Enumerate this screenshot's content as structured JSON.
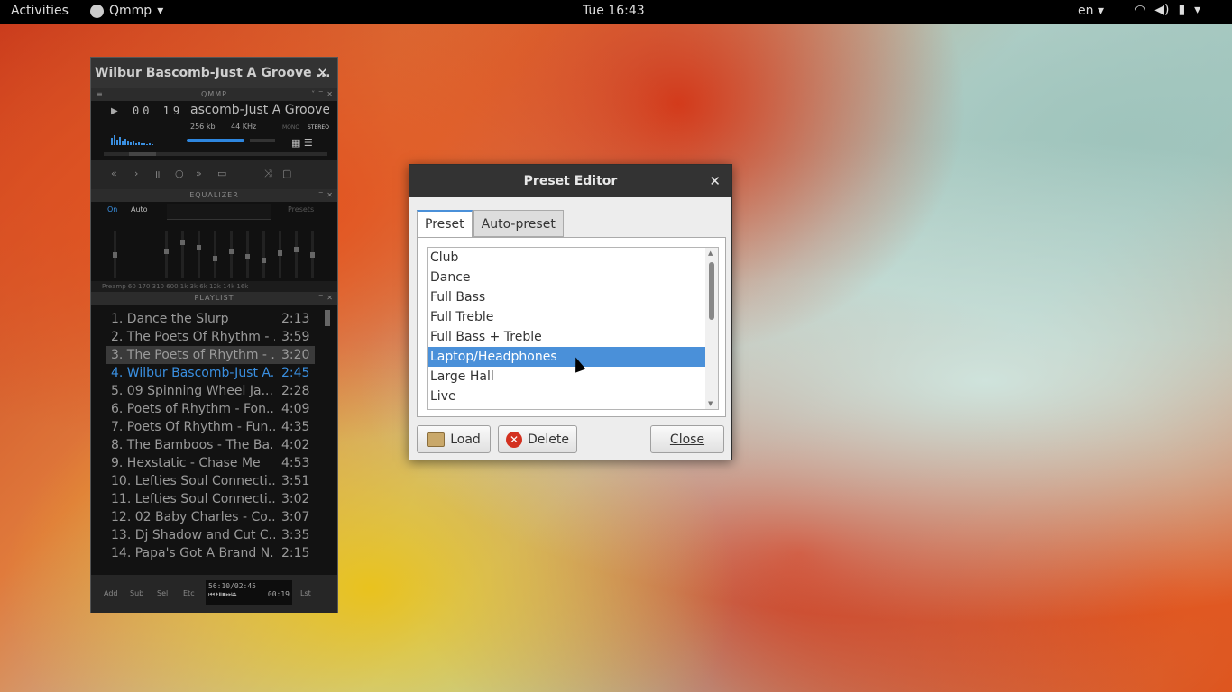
{
  "topbar": {
    "activities": "Activities",
    "app_name": "Qmmp",
    "clock": "Tue 16:43",
    "language": "en"
  },
  "qmmp": {
    "window_title": "Wilbur Bascomb-Just A Groove ...",
    "main_bar_label": "QMMP",
    "time": "00 19",
    "marquee": "ascomb-Just A Groove In",
    "bitrate": "256 kb",
    "samplerate": "44 KHz",
    "mono": "MONO",
    "stereo": "STEREO",
    "equalizer_label": "EQUALIZER",
    "eq_on": "On",
    "eq_auto": "Auto",
    "eq_presets": "Presets",
    "eq_footer": "Preamp      60  170  310  600   1k    3k    6k  12k  14k  16k",
    "playlist_label": "PLAYLIST",
    "playlist": [
      {
        "name": "1. Dance the Slurp",
        "time": "2:13"
      },
      {
        "name": "2. The Poets Of Rhythm - ...",
        "time": "3:59"
      },
      {
        "name": "3. The Poets of Rhythm - ...",
        "time": "3:20"
      },
      {
        "name": "4. Wilbur Bascomb-Just A...",
        "time": "2:45"
      },
      {
        "name": "5. 09 Spinning Wheel Ja...",
        "time": "2:28"
      },
      {
        "name": "6. Poets of Rhythm - Fon...",
        "time": "4:09"
      },
      {
        "name": "7. Poets Of Rhythm - Fun...",
        "time": "4:35"
      },
      {
        "name": "8. The Bamboos - The Ba...",
        "time": "4:02"
      },
      {
        "name": "9. Hexstatic - Chase Me",
        "time": "4:53"
      },
      {
        "name": "10. Lefties Soul Connecti...",
        "time": "3:51"
      },
      {
        "name": "11. Lefties Soul Connecti...",
        "time": "3:02"
      },
      {
        "name": "12. 02 Baby Charles - Co...",
        "time": "3:07"
      },
      {
        "name": "13. Dj Shadow and Cut C...",
        "time": "3:35"
      },
      {
        "name": "14. Papa's Got A Brand N...",
        "time": "2:15"
      }
    ],
    "foot_add": "Add",
    "foot_sub": "Sub",
    "foot_sel": "Sel",
    "foot_etc": "Etc",
    "foot_lst": "Lst",
    "foot_total": "56:10/02:45",
    "foot_elapsed": "00:19"
  },
  "dialog": {
    "title": "Preset Editor",
    "tabs": [
      "Preset",
      "Auto-preset"
    ],
    "presets": [
      "Club",
      "Dance",
      "Full Bass",
      "Full Treble",
      "Full Bass + Treble",
      "Laptop/Headphones",
      "Large Hall",
      "Live"
    ],
    "selected_index": 5,
    "load_label": "Load",
    "delete_label": "Delete",
    "close_label": "Close"
  }
}
